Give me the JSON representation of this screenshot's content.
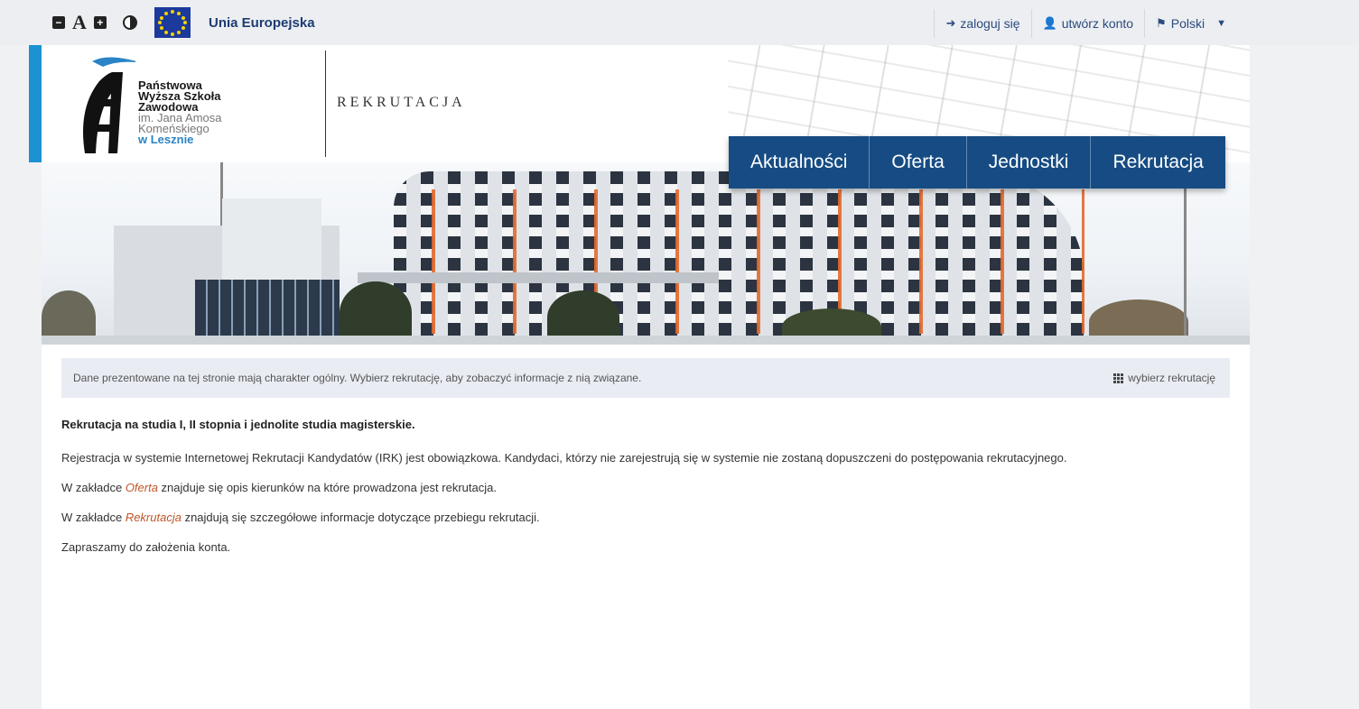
{
  "accessibility": {
    "decrease_font": "−",
    "font_letter": "A",
    "increase_font": "+"
  },
  "eu": {
    "label": "Unia Europejska"
  },
  "userbar": {
    "login_label": "zaloguj się",
    "register_label": "utwórz konto",
    "language_label": "Polski"
  },
  "logo": {
    "line1": "Państwowa",
    "line2": "Wyższa Szkoła",
    "line3": "Zawodowa",
    "line4": "im. Jana Amosa",
    "line5": "Komeńskiego",
    "line6": "w Lesznie"
  },
  "header": {
    "title": "REKRUTACJA"
  },
  "nav": {
    "items": [
      "Aktualności",
      "Oferta",
      "Jednostki",
      "Rekrutacja"
    ]
  },
  "infobar": {
    "message": "Dane prezentowane na tej stronie mają charakter ogólny. Wybierz rekrutację, aby zobaczyć informacje z nią związane.",
    "choose_label": "wybierz rekrutację"
  },
  "content": {
    "heading": "Rekrutacja na studia I, II stopnia i jednolite studia magisterskie.",
    "p1": "Rejestracja w systemie Internetowej Rekrutacji Kandydatów (IRK) jest obowiązkowa. Kandydaci, którzy nie zarejestrują się w systemie nie zostaną dopuszczeni do postępowania rekrutacyjnego.",
    "p2_before": "W zakładce ",
    "p2_link": "Oferta",
    "p2_after": " znajduje się opis kierunków na które prowadzona jest rekrutacja.",
    "p3_before": "W zakładce ",
    "p3_link": "Rekrutacja",
    "p3_after": " znajdują się szczegółowe informacje dotyczące przebiegu rekrutacji.",
    "p4": "Zapraszamy do założenia konta."
  },
  "colors": {
    "nav_bg": "#164c83",
    "accent_stripe": "#1c92d2",
    "link": "#c0582a",
    "infobar_bg": "#e9edf3"
  },
  "icons": {
    "login": "sign-in-icon",
    "register": "user-plus-icon",
    "language": "flag-icon",
    "choose": "grid-icon"
  }
}
